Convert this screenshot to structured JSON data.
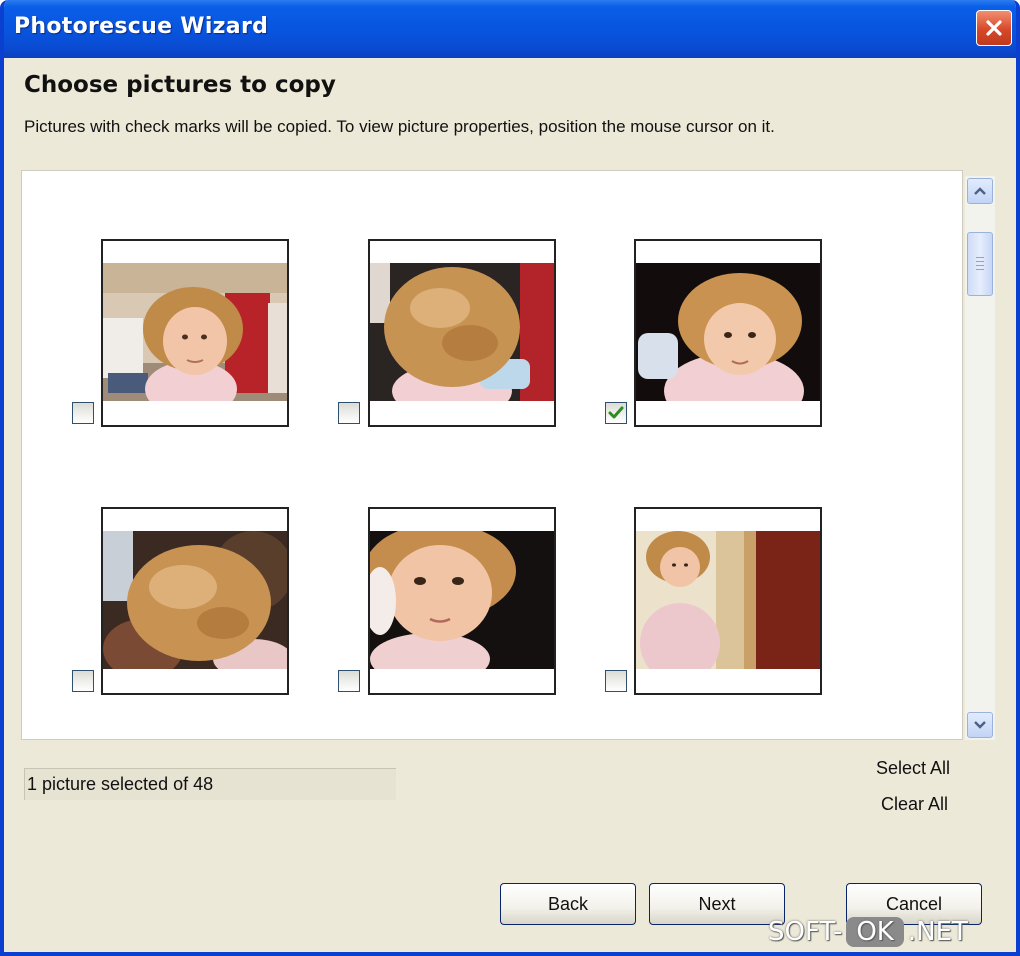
{
  "window": {
    "title": "Photorescue Wizard"
  },
  "page": {
    "heading": "Choose pictures to copy",
    "instructions": "Pictures with check marks will be copied.  To view picture properties, position the mouse cursor on it."
  },
  "thumbnails": [
    {
      "checked": false
    },
    {
      "checked": false
    },
    {
      "checked": true
    },
    {
      "checked": false
    },
    {
      "checked": false
    },
    {
      "checked": false
    }
  ],
  "status": "1 picture selected of 48",
  "links": {
    "select_all": "Select All",
    "clear_all": "Clear All"
  },
  "buttons": {
    "back": "Back",
    "next": "Next",
    "cancel": "Cancel"
  },
  "watermark": {
    "left": "SOFT-",
    "middle": "OK",
    "right": ".NET"
  },
  "colors": {
    "titlebar": "#0854de",
    "dialog_bg": "#ece9d8",
    "close": "#d8482a",
    "check": "#2e8b22"
  }
}
